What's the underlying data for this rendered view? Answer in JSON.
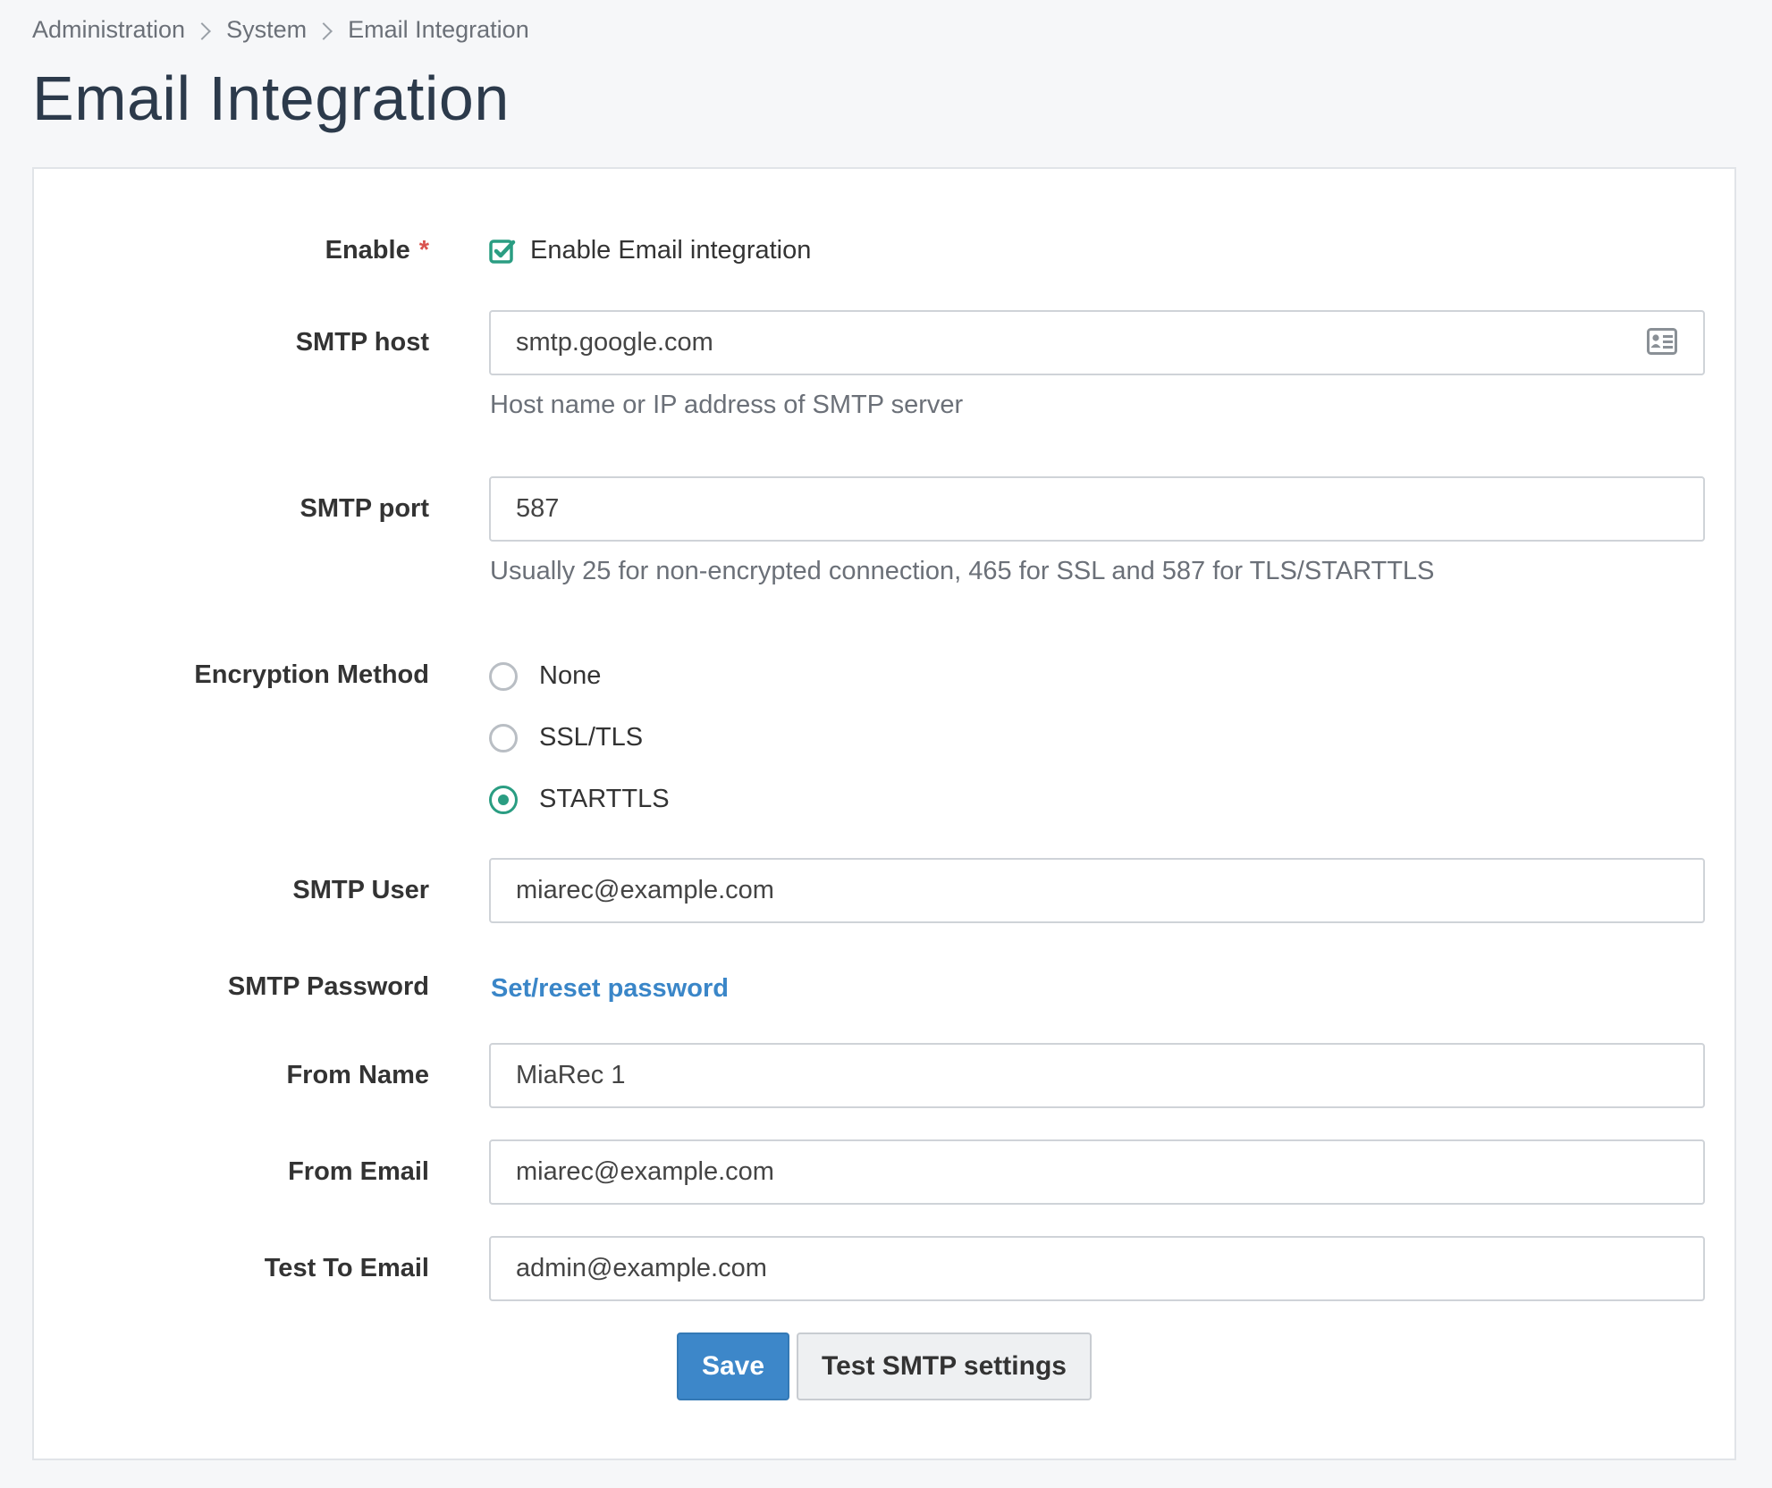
{
  "breadcrumb": {
    "items": [
      "Administration",
      "System",
      "Email Integration"
    ]
  },
  "page": {
    "title": "Email Integration"
  },
  "form": {
    "enable": {
      "label": "Enable",
      "required_mark": "*",
      "checkbox_label": "Enable Email integration",
      "checked": true
    },
    "smtp_host": {
      "label": "SMTP host",
      "value": "smtp.google.com",
      "help": "Host name or IP address of SMTP server",
      "icon": "contact-card-icon"
    },
    "smtp_port": {
      "label": "SMTP port",
      "value": "587",
      "help": "Usually 25 for non-encrypted connection, 465 for SSL and 587 for TLS/STARTTLS"
    },
    "encryption": {
      "label": "Encryption Method",
      "options": [
        "None",
        "SSL/TLS",
        "STARTTLS"
      ],
      "selected": "STARTTLS"
    },
    "smtp_user": {
      "label": "SMTP User",
      "value": "miarec@example.com"
    },
    "smtp_password": {
      "label": "SMTP Password",
      "link": "Set/reset password"
    },
    "from_name": {
      "label": "From Name",
      "value": "MiaRec 1"
    },
    "from_email": {
      "label": "From Email",
      "value": "miarec@example.com"
    },
    "test_to_email": {
      "label": "Test To Email",
      "value": "admin@example.com"
    }
  },
  "actions": {
    "save_label": "Save",
    "test_label": "Test SMTP settings"
  },
  "colors": {
    "primary": "#3d87c9",
    "accent": "#2a9d82",
    "required": "#d9534f",
    "link": "#3a86c8"
  }
}
